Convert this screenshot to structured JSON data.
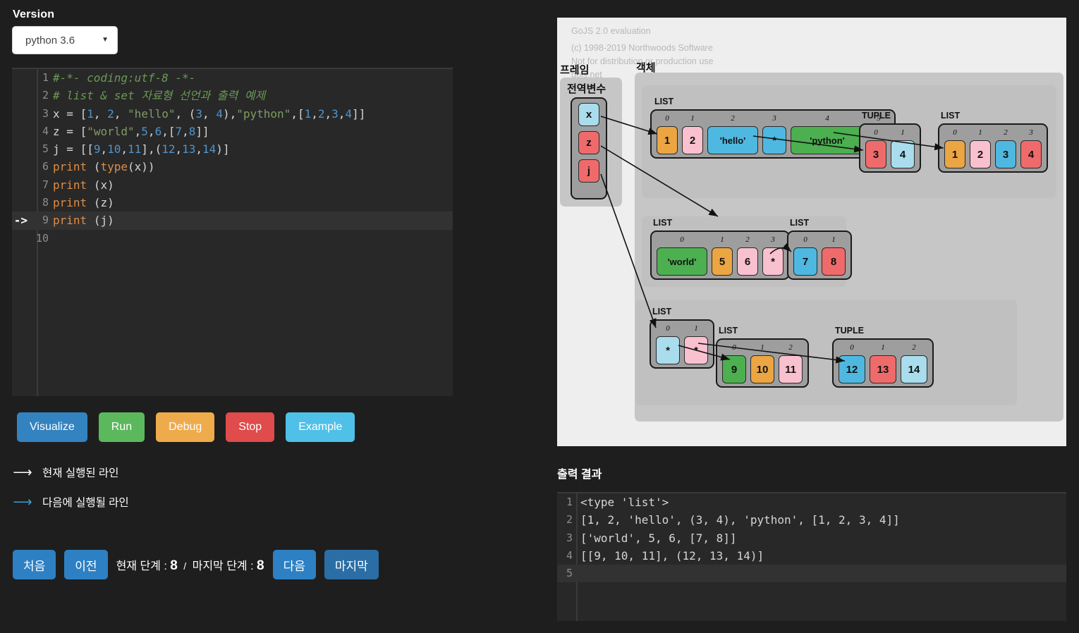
{
  "version": {
    "label": "Version",
    "value": "python 3.6",
    "caret": "chevron-down-icon"
  },
  "editor": {
    "current_line_marker": "->",
    "lines": [
      {
        "n": "1",
        "text": "#-*- coding:utf-8 -*-"
      },
      {
        "n": "2",
        "text": "# list & set 자료형 선언과 출력 예제"
      },
      {
        "n": "3",
        "text": "x = [1, 2, \"hello\", (3, 4),\"python\",[1,2,3,4]]"
      },
      {
        "n": "4",
        "text": "z = [\"world\",5,6,[7,8]]"
      },
      {
        "n": "5",
        "text": "j = [[9,10,11],(12,13,14)]"
      },
      {
        "n": "6",
        "text": "print (type(x))"
      },
      {
        "n": "7",
        "text": "print (x)"
      },
      {
        "n": "8",
        "text": "print (z)"
      },
      {
        "n": "9",
        "text": "print (j)"
      },
      {
        "n": "10",
        "text": ""
      }
    ]
  },
  "buttons": [
    {
      "label": "Visualize",
      "color": "#3383c0"
    },
    {
      "label": "Run",
      "color": "#5cb85c"
    },
    {
      "label": "Debug",
      "color": "#efab4b"
    },
    {
      "label": "Stop",
      "color": "#e04b4b"
    },
    {
      "label": "Example",
      "color": "#4fc0e8"
    }
  ],
  "legend": [
    {
      "arrow": "⟶",
      "color": "#ffffff",
      "text": "현재 실행된 라인"
    },
    {
      "arrow": "⟶",
      "color": "#3b9fd4",
      "text": "다음에 실행될 라인"
    }
  ],
  "step": {
    "first": "처음",
    "prev": "이전",
    "current_label": "현재 단계 :",
    "current_value": "8",
    "separator": "/",
    "last_label": "마지막 단계 :",
    "last_value": "8",
    "next": "다음",
    "last": "마지막"
  },
  "diagram": {
    "watermark": [
      "GoJS 2.0 evaluation",
      "(c) 1998-2019 Northwoods Software",
      "Not for distribution or production use",
      "gojs.net"
    ],
    "labels": {
      "frame": "프레임",
      "object": "객체",
      "globals": "전역변수"
    },
    "variables": [
      {
        "name": "x",
        "color": "#a9dcec"
      },
      {
        "name": "z",
        "color": "#ef6b6b"
      },
      {
        "name": "j",
        "color": "#ef6b6b"
      }
    ],
    "structures": [
      {
        "kind": "LIST",
        "id": "x-list",
        "indices": [
          "0",
          "1",
          "2",
          "3",
          "4",
          "5"
        ],
        "cells": [
          {
            "value": "1",
            "color": "#eba543"
          },
          {
            "value": "2",
            "color": "#f9c0d0"
          },
          {
            "value": "'hello'",
            "color": "#4fb8e0"
          },
          {
            "value": "*",
            "color": "#4fb8e0"
          },
          {
            "value": "'python'",
            "color": "#4caf50"
          },
          {
            "value": "*",
            "color": "#4caf50"
          }
        ]
      },
      {
        "kind": "TUPLE",
        "id": "x3-tuple",
        "indices": [
          "0",
          "1"
        ],
        "cells": [
          {
            "value": "3",
            "color": "#ef6b6b"
          },
          {
            "value": "4",
            "color": "#a9dcec"
          }
        ]
      },
      {
        "kind": "LIST",
        "id": "x5-list",
        "indices": [
          "0",
          "1",
          "2",
          "3"
        ],
        "cells": [
          {
            "value": "1",
            "color": "#eba543"
          },
          {
            "value": "2",
            "color": "#f9c0d0"
          },
          {
            "value": "3",
            "color": "#4fb8e0"
          },
          {
            "value": "4",
            "color": "#ef6b6b"
          }
        ]
      },
      {
        "kind": "LIST",
        "id": "z-list",
        "indices": [
          "0",
          "1",
          "2",
          "3"
        ],
        "cells": [
          {
            "value": "'world'",
            "color": "#4caf50"
          },
          {
            "value": "5",
            "color": "#eba543"
          },
          {
            "value": "6",
            "color": "#f9c0d0"
          },
          {
            "value": "*",
            "color": "#f9c0d0"
          }
        ]
      },
      {
        "kind": "LIST",
        "id": "z3-list",
        "indices": [
          "0",
          "1"
        ],
        "cells": [
          {
            "value": "7",
            "color": "#4fb8e0"
          },
          {
            "value": "8",
            "color": "#ef6b6b"
          }
        ]
      },
      {
        "kind": "LIST",
        "id": "j-list",
        "indices": [
          "0",
          "1"
        ],
        "cells": [
          {
            "value": "*",
            "color": "#a9dcec"
          },
          {
            "value": "*",
            "color": "#f9c0d0"
          }
        ]
      },
      {
        "kind": "LIST",
        "id": "j0-list",
        "indices": [
          "0",
          "1",
          "2"
        ],
        "cells": [
          {
            "value": "9",
            "color": "#4caf50"
          },
          {
            "value": "10",
            "color": "#eba543"
          },
          {
            "value": "11",
            "color": "#f9c0d0"
          }
        ]
      },
      {
        "kind": "TUPLE",
        "id": "j1-tuple",
        "indices": [
          "0",
          "1",
          "2"
        ],
        "cells": [
          {
            "value": "12",
            "color": "#4fb8e0"
          },
          {
            "value": "13",
            "color": "#ef6b6b"
          },
          {
            "value": "14",
            "color": "#a9dcec"
          }
        ]
      }
    ]
  },
  "output": {
    "title": "출력 결과",
    "lines": [
      {
        "n": "1",
        "text": "<type 'list'>"
      },
      {
        "n": "2",
        "text": "[1, 2, 'hello', (3, 4), 'python', [1, 2, 3, 4]]"
      },
      {
        "n": "3",
        "text": "['world', 5, 6, [7, 8]]"
      },
      {
        "n": "4",
        "text": "[[9, 10, 11], (12, 13, 14)]"
      },
      {
        "n": "5",
        "text": ""
      }
    ]
  }
}
